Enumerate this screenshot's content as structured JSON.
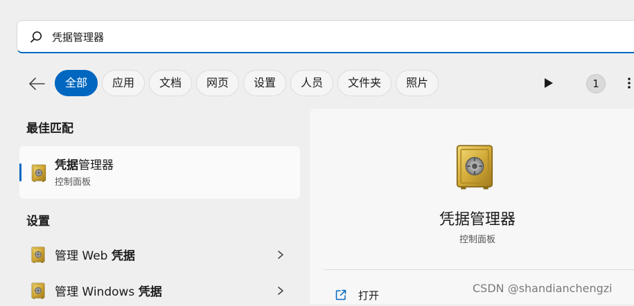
{
  "search": {
    "query": "凭据管理器",
    "icon": "search-icon"
  },
  "filters": {
    "back_icon": "back-arrow-icon",
    "chips": [
      "全部",
      "应用",
      "文档",
      "网页",
      "设置",
      "人员",
      "文件夹",
      "照片"
    ],
    "active_index": 0,
    "play_icon": "play-icon",
    "badge_count": "1",
    "more_icon": "more-icon"
  },
  "best_match": {
    "heading": "最佳匹配",
    "item": {
      "name_bold": "凭据",
      "name_rest": "管理器",
      "subtitle": "控制面板",
      "icon": "credential-vault-icon"
    }
  },
  "settings": {
    "heading": "设置",
    "items": [
      {
        "prefix": "管理 Web ",
        "bold": "凭据",
        "icon": "credential-vault-icon"
      },
      {
        "prefix": "管理 Windows ",
        "bold": "凭据",
        "icon": "credential-vault-icon"
      }
    ]
  },
  "detail": {
    "title": "凭据管理器",
    "subtitle": "控制面板",
    "open_label": "打开",
    "open_icon": "open-external-icon"
  },
  "watermark": "CSDN @shandianchengzi",
  "colors": {
    "accent": "#0067c0",
    "background": "#efefef",
    "vault_gold": "#c9a227"
  }
}
